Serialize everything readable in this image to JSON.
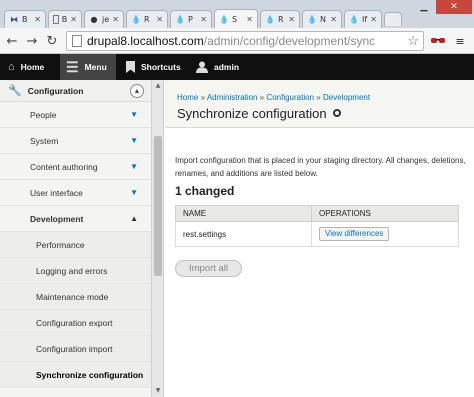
{
  "browser": {
    "tabs": [
      {
        "label": "B",
        "icon": "puzzle-icon"
      },
      {
        "label": "B",
        "icon": "page-icon"
      },
      {
        "label": "je",
        "icon": "github-icon"
      },
      {
        "label": "R",
        "icon": "drupal-icon"
      },
      {
        "label": "P",
        "icon": "drupal-icon"
      },
      {
        "label": "S",
        "icon": "drupal-icon",
        "active": true
      },
      {
        "label": "R",
        "icon": "drupal-icon"
      },
      {
        "label": "N",
        "icon": "drupal-icon"
      },
      {
        "label": "If",
        "icon": "drupal-icon"
      }
    ],
    "address": {
      "host": "drupal8.localhost.com",
      "path": "/admin/config/development/sync"
    }
  },
  "admin_toolbar": {
    "home": "Home",
    "menu": "Menu",
    "shortcuts": "Shortcuts",
    "user": "admin"
  },
  "sidebar": {
    "heading": "Configuration",
    "items": [
      {
        "label": "People"
      },
      {
        "label": "System"
      },
      {
        "label": "Content authoring"
      },
      {
        "label": "User interface"
      },
      {
        "label": "Development"
      }
    ],
    "sub_items": [
      {
        "label": "Performance"
      },
      {
        "label": "Logging and errors"
      },
      {
        "label": "Maintenance mode"
      },
      {
        "label": "Configuration export"
      },
      {
        "label": "Configuration import"
      },
      {
        "label": "Synchronize configuration"
      }
    ]
  },
  "page": {
    "breadcrumb": [
      "Home",
      "Administration",
      "Configuration",
      "Development"
    ],
    "title": "Synchronize configuration",
    "description": "Import configuration that is placed in your staging directory. All changes, deletions, renames, and additions are listed below.",
    "changed_heading": "1 changed",
    "table": {
      "headers": [
        "NAME",
        "OPERATIONS"
      ],
      "rows": [
        {
          "name": "rest.settings",
          "operation": "View differences"
        }
      ]
    },
    "import_button": "Import all"
  },
  "colors": {
    "link": "#0074bd",
    "admin_bar": "#0f0f0f",
    "window_close": "#c9463d"
  }
}
